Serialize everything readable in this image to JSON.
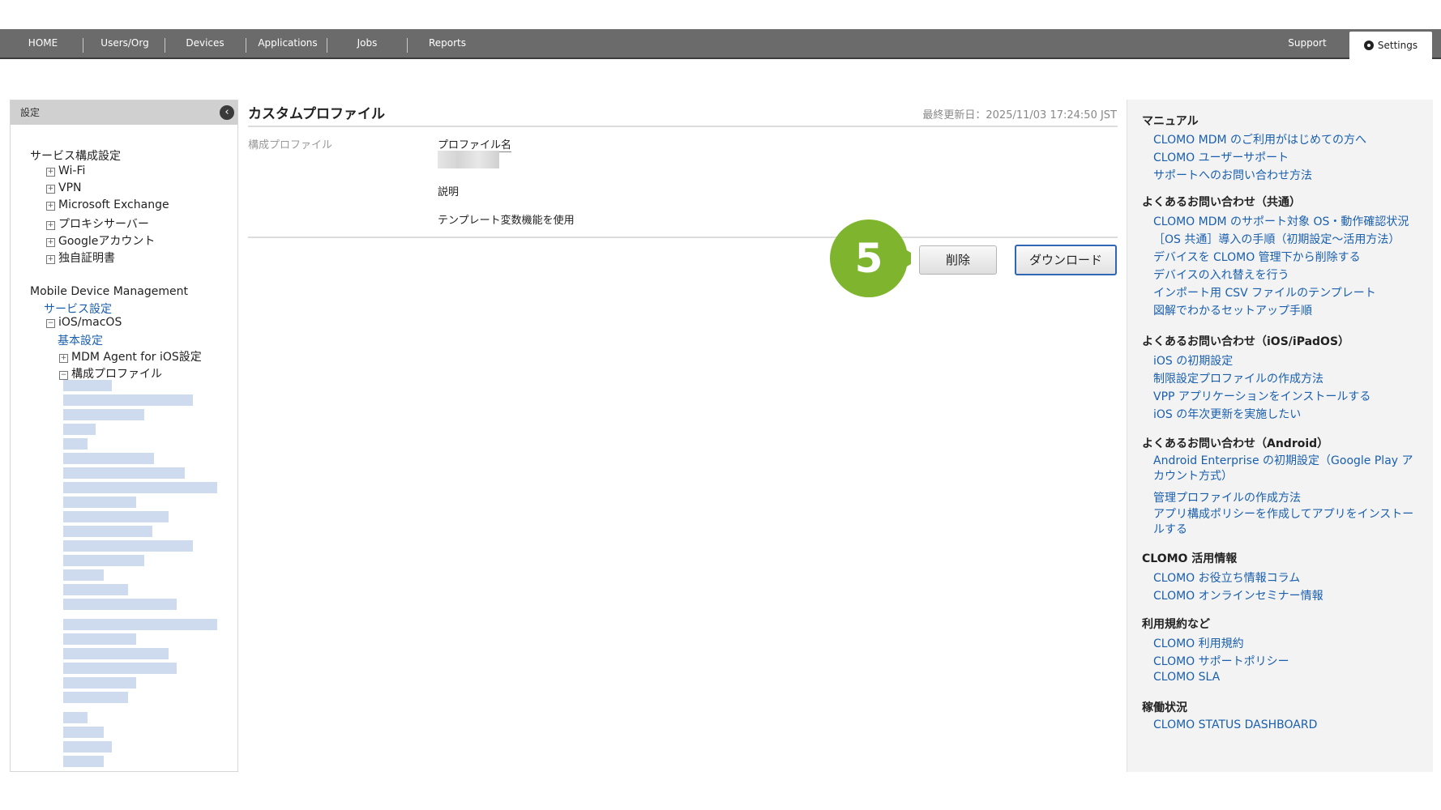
{
  "nav": {
    "items": [
      "HOME",
      "Users/Org",
      "Devices",
      "Applications",
      "Jobs",
      "Reports"
    ],
    "support": "Support",
    "settings": "Settings"
  },
  "sidebar": {
    "header": "設定",
    "section1": "サービス構成設定",
    "section1_items": [
      "Wi-Fi",
      "VPN",
      "Microsoft Exchange",
      "プロキシサーバー",
      "Googleアカウント",
      "独自証明書"
    ],
    "section2": "Mobile Device Management",
    "service_settings": "サービス設定",
    "ios_macos": "iOS/macOS",
    "basic_settings": "基本設定",
    "mdm_agent": "MDM Agent for iOS設定",
    "config_profiles": "構成プロファイル"
  },
  "main": {
    "title": "カスタムプロファイル",
    "last_updated": "最終更新日：2025/11/03 17:24:50 JST",
    "section_label": "構成プロファイル",
    "profile_name_label": "プロファイル名",
    "description_label": "説明",
    "template_label": "テンプレート変数機能を使用",
    "delete_button": "削除",
    "download_button": "ダウンロード",
    "step_number": "5"
  },
  "help": {
    "manual_heading": "マニュアル",
    "manual_links": [
      "CLOMO MDM のご利用がはじめての方へ",
      "CLOMO ユーザーサポート",
      "サポートへのお問い合わせ方法"
    ],
    "faq_common_heading": "よくあるお問い合わせ（共通）",
    "faq_common_links": [
      "CLOMO MDM のサポート対象 OS・動作確認状況",
      "［OS 共通］導入の手順（初期設定〜活用方法）",
      "デバイスを CLOMO 管理下から削除する",
      "デバイスの入れ替えを行う",
      "インポート用 CSV ファイルのテンプレート",
      "図解でわかるセットアップ手順"
    ],
    "faq_ios_heading": "よくあるお問い合わせ（iOS/iPadOS）",
    "faq_ios_links": [
      "iOS の初期設定",
      "制限設定プロファイルの作成方法",
      "VPP アプリケーションをインストールする",
      "iOS の年次更新を実施したい"
    ],
    "faq_android_heading": "よくあるお問い合わせ（Android）",
    "faq_android_links": [
      "Android Enterprise の初期設定（Google Play アカウント方式）",
      "管理プロファイルの作成方法",
      "アプリ構成ポリシーを作成してアプリをインストールする"
    ],
    "clomo_info_heading": "CLOMO 活用情報",
    "clomo_info_links": [
      "CLOMO お役立ち情報コラム",
      "CLOMO オンラインセミナー情報"
    ],
    "terms_heading": "利用規約など",
    "terms_links": [
      "CLOMO 利用規約",
      "CLOMO サポートポリシー",
      "CLOMO SLA"
    ],
    "status_heading": "稼働状況",
    "status_links": [
      "CLOMO STATUS DASHBOARD"
    ]
  },
  "colors": {
    "nav_bg": "#6b6b6b",
    "link": "#1a5fae",
    "step_badge": "#7fb52e"
  }
}
